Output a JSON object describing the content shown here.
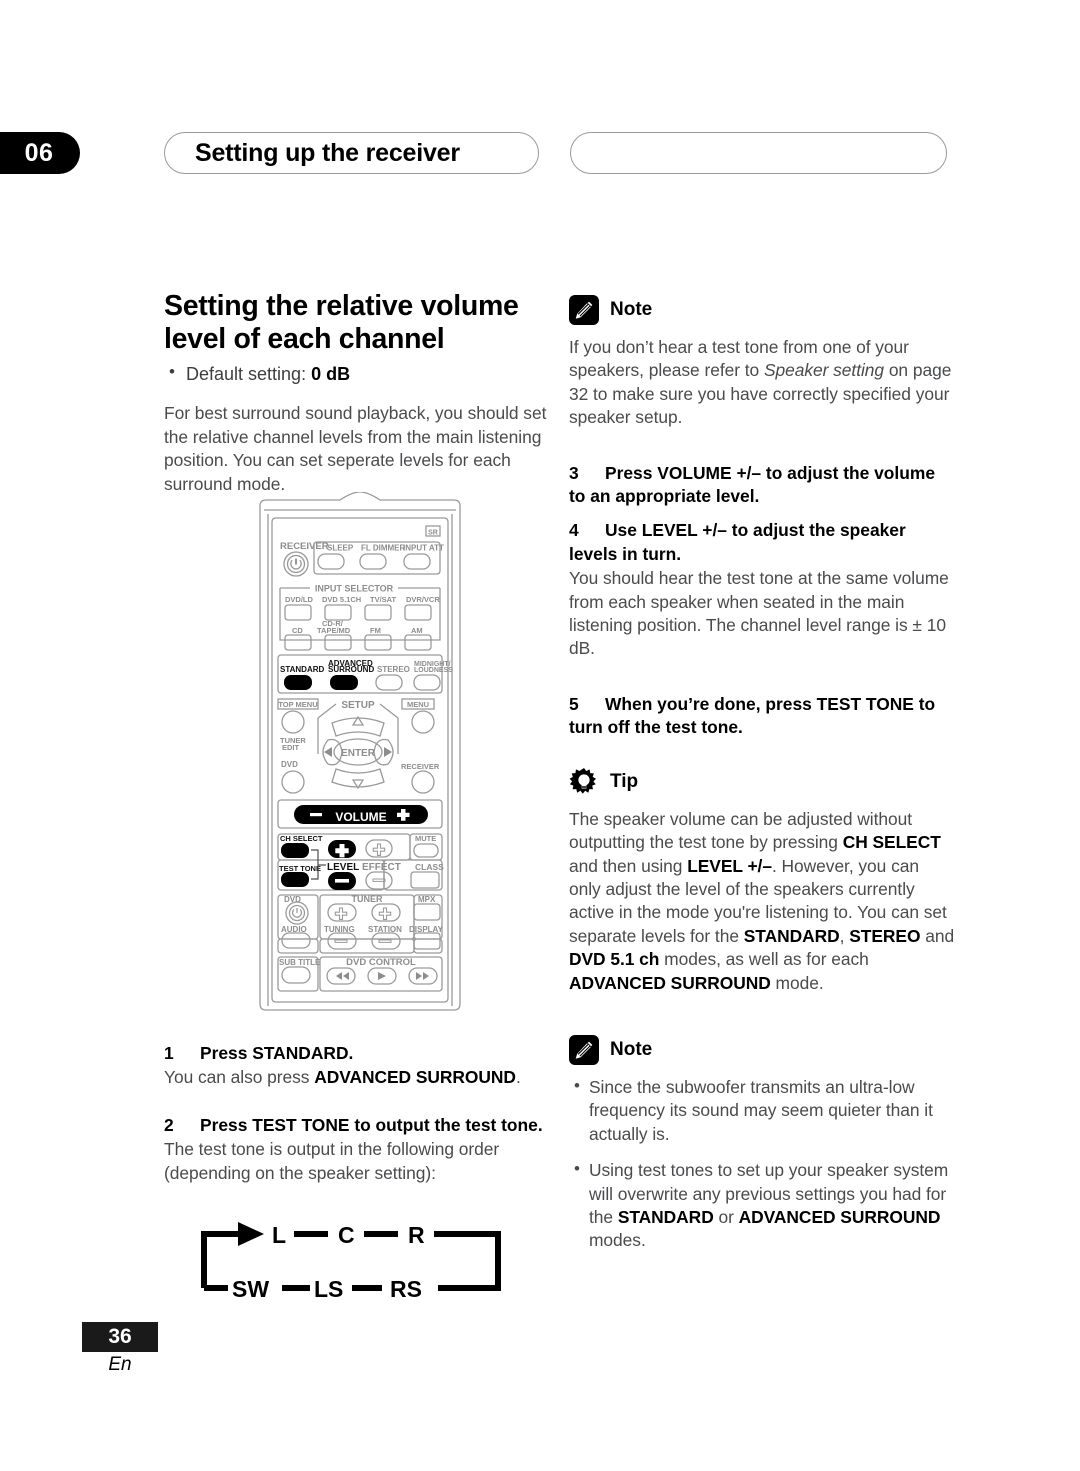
{
  "header": {
    "chapter_number": "06",
    "chapter_title": "Setting up the receiver",
    "blank_capsule": ""
  },
  "left_column": {
    "section_heading": "Setting the relative volume level of each channel",
    "default_setting_label": "Default setting:",
    "default_setting_value": "0 dB",
    "intro_paragraph": "For best surround sound playback, you should set the relative channel levels from the main listening position. You can set seperate levels for each surround mode.",
    "step1_number": "1",
    "step1_title": "Press STANDARD.",
    "step1_body_pre": "You can also press ",
    "step1_body_bold": "ADVANCED SURROUND",
    "step1_body_post": ".",
    "step2_number": "2",
    "step2_title": "Press TEST TONE to output the test tone.",
    "step2_body": "The test tone is output in the following order (depending on the speaker setting):"
  },
  "speaker_order": {
    "top_row": [
      "L",
      "C",
      "R"
    ],
    "bottom_row": [
      "SW",
      "LS",
      "RS"
    ]
  },
  "right_column": {
    "note1_label": "Note",
    "note1_body_a": "If you don’t hear a test tone from one of your speakers, please refer to ",
    "note1_body_italic": "Speaker setting",
    "note1_body_b": " on page 32 to make sure you have correctly specified your speaker setup.",
    "step3_number": "3",
    "step3_title": "Press VOLUME +/– to adjust the volume to an appropriate level.",
    "step4_number": "4",
    "step4_title": "Use LEVEL +/– to adjust the speaker levels in turn.",
    "step4_body": "You should hear the test tone at the same volume from each speaker when seated in the main listening position. The channel level range is ± 10 dB.",
    "step5_number": "5",
    "step5_title": "When you’re done, press TEST TONE to turn off the test tone.",
    "tip_label": "Tip",
    "tip_body_1": "The speaker volume can be adjusted without outputting the test tone by pressing ",
    "tip_bold_1": "CH SELECT",
    "tip_body_2": " and then using ",
    "tip_bold_2": "LEVEL +/–",
    "tip_body_3": ". However, you can only adjust the level of the speakers currently active in the mode you're listening to. You can set separate levels for the ",
    "tip_bold_3": "STANDARD",
    "tip_body_4": ", ",
    "tip_bold_4": "STEREO",
    "tip_body_5": " and ",
    "tip_bold_5": "DVD 5.1 ch",
    "tip_body_6": " modes, as well as for each ",
    "tip_bold_6": "ADVANCED SURROUND",
    "tip_body_7": " mode.",
    "note2_label": "Note",
    "note2_bullet1": "Since the subwoofer transmits an ultra-low frequency its sound may seem quieter than it actually is.",
    "note2_bullet2_a": "Using test tones to set up your speaker system will overwrite any previous settings you had for the ",
    "note2_bullet2_bold1": "STANDARD",
    "note2_bullet2_b": " or ",
    "note2_bullet2_bold2": "ADVANCED SURROUND",
    "note2_bullet2_c": " modes."
  },
  "remote": {
    "sr_badge": "SR",
    "receiver_label": "RECEIVER",
    "top_buttons": [
      "SLEEP",
      "FL DIMMER",
      "INPUT ATT"
    ],
    "input_selector_label": "INPUT SELECTOR",
    "input_row1": [
      "DVD/LD",
      "DVD 5.1CH",
      "TV/SAT",
      "DVR/VCR"
    ],
    "input_row2": [
      "CD",
      "CD-R/ TAPE/MD",
      "FM",
      "AM"
    ],
    "mode_buttons": [
      "STANDARD",
      "ADVANCED SURROUND",
      "STEREO",
      "MIDNIGHT/ LOUDNESS"
    ],
    "top_menu_label": "TOP MENU",
    "setup_label": "SETUP",
    "menu_label": "MENU",
    "tuner_edit_label": "TUNER EDIT",
    "enter_label": "ENTER",
    "dvd_label": "DVD",
    "receiver_right_label": "RECEIVER",
    "volume_label": "VOLUME",
    "volume_minus": "–",
    "volume_plus": "+",
    "ch_select_label": "CH SELECT",
    "test_tone_label": "TEST TONE",
    "level_label": "LEVEL",
    "effect_label": "EFFECT",
    "mute_label": "MUTE",
    "class_label": "CLASS",
    "dvd_power_label": "DVD",
    "tuner_label": "TUNER",
    "mpx_label": "MPX",
    "audio_label": "AUDIO",
    "tuning_label": "TUNING",
    "station_label": "STATION",
    "display_label": "DISPLAY",
    "sub_title_label": "SUB TITLE",
    "dvd_control_label": "DVD CONTROL"
  },
  "footer": {
    "page_number": "36",
    "language": "En"
  },
  "colors": {
    "ink": "#231f20",
    "body_gray": "#4a4b4d",
    "remote_gray": "#8d8d8d",
    "black": "#000000"
  }
}
